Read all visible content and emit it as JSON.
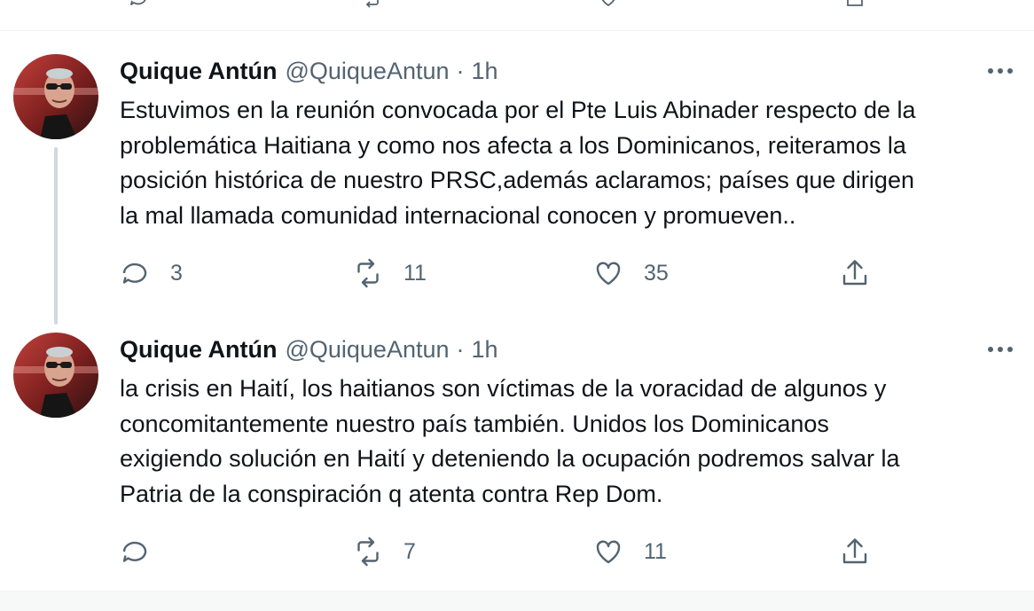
{
  "colors": {
    "text": "#0f1419",
    "muted": "#536471",
    "divider": "#eff3f4",
    "thread_line": "#cfd9de"
  },
  "tweets": [
    {
      "author": {
        "name": "Quique Antún",
        "handle": "@QuiqueAntun"
      },
      "separator": "·",
      "time": "1h",
      "lines": [
        "Estuvimos en la reunión convocada por el Pte Luis Abinader respecto de la",
        "problemática Haitiana y como nos afecta a los Dominicanos, reiteramos la",
        "posición histórica de nuestro PRSC,además aclaramos; países que dirigen",
        "la mal llamada comunidad internacional conocen y promueven.."
      ],
      "replies": "3",
      "retweets": "11",
      "likes": "35"
    },
    {
      "author": {
        "name": "Quique Antún",
        "handle": "@QuiqueAntun"
      },
      "separator": "·",
      "time": "1h",
      "lines": [
        "la crisis en Haití, los haitianos son víctimas de la voracidad de algunos y",
        "concomitantemente nuestro país también. Unidos los Dominicanos",
        "exigiendo solución en Haití y deteniendo la ocupación podremos salvar la",
        "Patria de la conspiración q atenta contra Rep Dom."
      ],
      "replies": "",
      "retweets": "7",
      "likes": "11"
    }
  ],
  "icons": [
    "reply-icon",
    "retweet-icon",
    "like-icon",
    "share-icon",
    "more-icon"
  ]
}
